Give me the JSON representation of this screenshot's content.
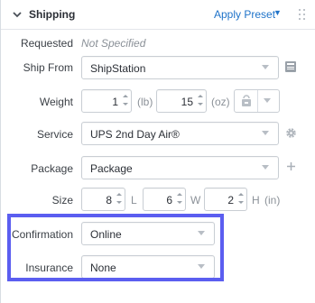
{
  "header": {
    "title": "Shipping",
    "apply_preset": "Apply Preset"
  },
  "requested": {
    "label": "Requested",
    "value": "Not Specified"
  },
  "ship_from": {
    "label": "Ship From",
    "value": "ShipStation"
  },
  "weight": {
    "label": "Weight",
    "lb_value": "1",
    "lb_unit": "(lb)",
    "oz_value": "15",
    "oz_unit": "(oz)"
  },
  "service": {
    "label": "Service",
    "value": "UPS 2nd Day Air®"
  },
  "package": {
    "label": "Package",
    "value": "Package"
  },
  "size": {
    "label": "Size",
    "length": "8",
    "length_unit": "L",
    "width": "6",
    "width_unit": "W",
    "height": "2",
    "height_unit": "H",
    "units": "(in)"
  },
  "confirmation": {
    "label": "Confirmation",
    "value": "Online"
  },
  "insurance": {
    "label": "Insurance",
    "value": "None"
  },
  "colors": {
    "accent": "#1f73c9",
    "highlight": "#5b5ef0"
  }
}
